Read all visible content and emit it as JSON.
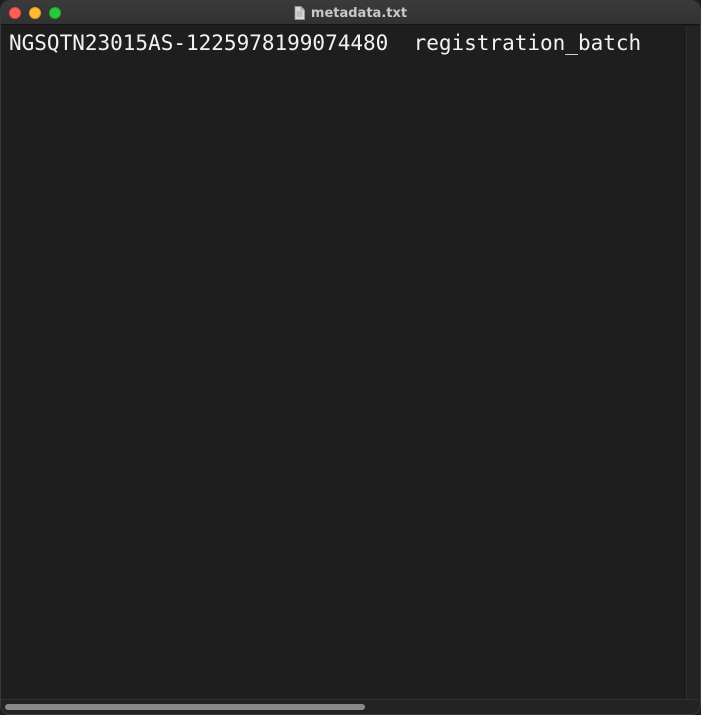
{
  "window": {
    "title": "metadata.txt",
    "title_icon": "document-icon"
  },
  "editor": {
    "lines": [
      "NGSQTN23015AS-1225978199074480  registration_batch"
    ]
  },
  "colors": {
    "background": "#1e1e1e",
    "text": "#f2f2f2",
    "close": "#ff5f57",
    "minimize": "#febc2e",
    "zoom": "#28c840"
  }
}
